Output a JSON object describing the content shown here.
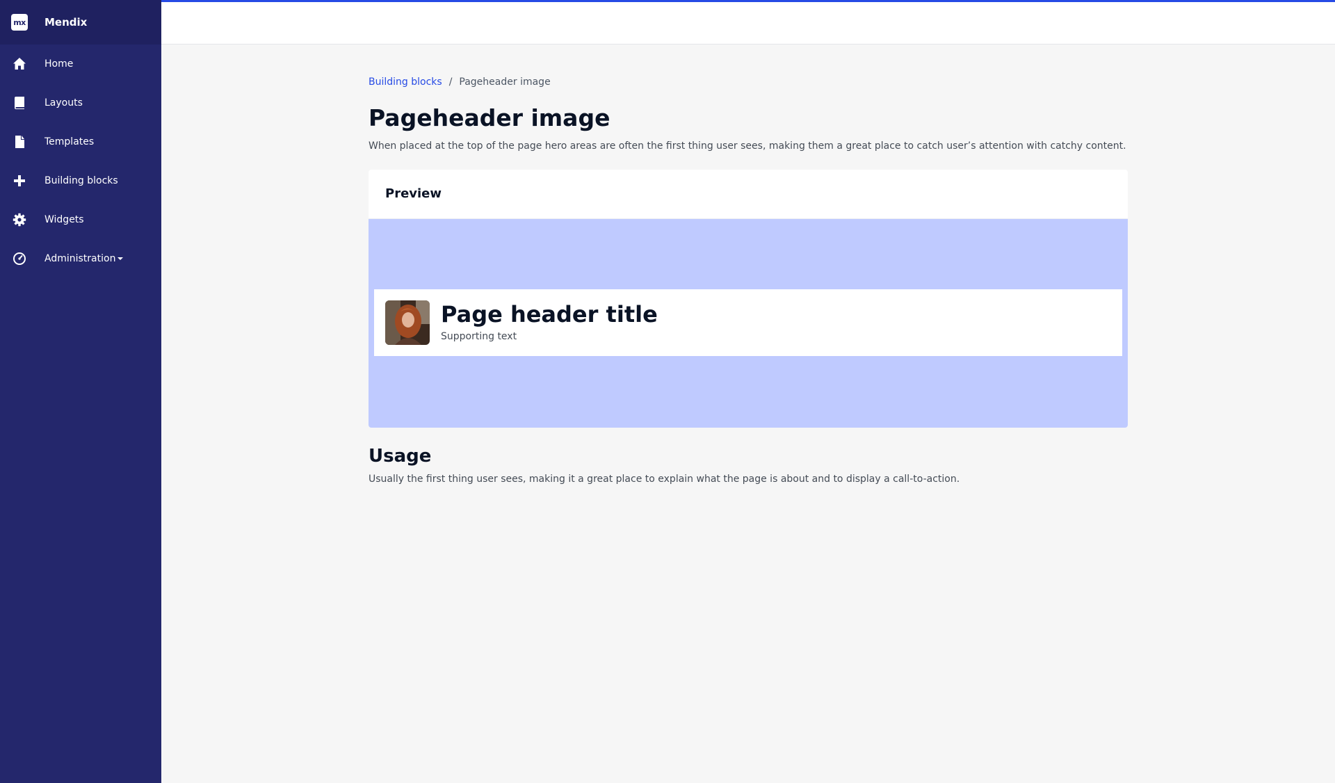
{
  "app": {
    "name": "Mendix",
    "logo_text": "mx"
  },
  "sidebar": {
    "items": [
      {
        "label": "Home",
        "icon": "home-icon"
      },
      {
        "label": "Layouts",
        "icon": "book-icon"
      },
      {
        "label": "Templates",
        "icon": "file-icon"
      },
      {
        "label": "Building blocks",
        "icon": "plus-icon"
      },
      {
        "label": "Widgets",
        "icon": "gear-icon"
      },
      {
        "label": "Administration",
        "icon": "gauge-icon"
      }
    ]
  },
  "breadcrumb": {
    "parent": "Building blocks",
    "separator": "/",
    "current": "Pageheader image"
  },
  "page": {
    "title": "Pageheader image",
    "description": "When placed at the top of the page hero areas are often the first thing user sees, making them a great place to catch user’s attention with catchy content."
  },
  "preview": {
    "heading": "Preview",
    "header_title": "Page header title",
    "supporting_text": "Supporting text"
  },
  "usage": {
    "title": "Usage",
    "description": "Usually the first thing user sees, making it a great place to explain what the page is about and to display a call-to-action."
  },
  "colors": {
    "sidebar": "#24276c",
    "accent": "#264ae5",
    "hero_background": "#bfcaff"
  }
}
